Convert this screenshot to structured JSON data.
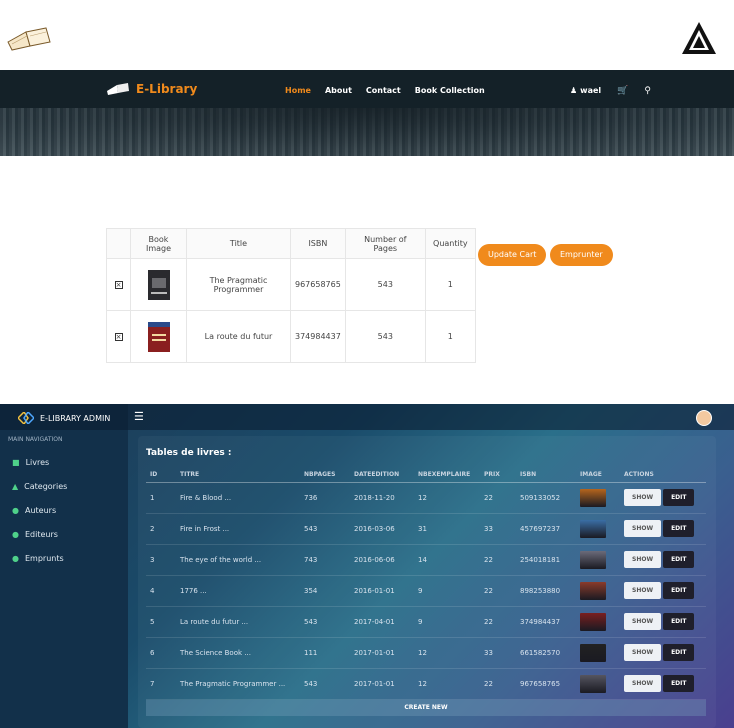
{
  "navbar": {
    "brand": "E-Library",
    "links": [
      "Home",
      "About",
      "Contact",
      "Book Collection"
    ],
    "active_link": "Home",
    "user": "wael"
  },
  "cart": {
    "headers": [
      "",
      "Book Image",
      "Title",
      "ISBN",
      "Number of Pages",
      "Quantity"
    ],
    "rows": [
      {
        "title": "The Pragmatic Programmer",
        "isbn": "967658765",
        "pages": "543",
        "quantity": "1",
        "cover": "dark"
      },
      {
        "title": "La route du futur",
        "isbn": "374984437",
        "pages": "543",
        "quantity": "1",
        "cover": "red"
      }
    ],
    "update_cart": "Update Cart",
    "emprunter": "Emprunter"
  },
  "admin": {
    "brand": "E-LIBRARY ADMIN",
    "sidebar_heading": "MAIN NAVIGATION",
    "sidebar_items": [
      "Livres",
      "Categories",
      "Auteurs",
      "Editeurs",
      "Emprunts"
    ],
    "card_title": "Tables de livres :",
    "columns": [
      "ID",
      "TITRE",
      "NBPAGES",
      "DATEEDITION",
      "NBEXEMPLAIRE",
      "PRIX",
      "ISBN",
      "IMAGE",
      "ACTIONS"
    ],
    "rows": [
      {
        "id": "1",
        "titre": "Fire & Blood ...",
        "nbpages": "736",
        "date": "2018-11-20",
        "nbex": "12",
        "prix": "22",
        "isbn": "509133052",
        "cover": "#b5651d"
      },
      {
        "id": "2",
        "titre": "Fire in Frost ...",
        "nbpages": "543",
        "date": "2016-03-06",
        "nbex": "31",
        "prix": "33",
        "isbn": "457697237",
        "cover": "#3a6ea5"
      },
      {
        "id": "3",
        "titre": "The eye of the world ...",
        "nbpages": "743",
        "date": "2016-06-06",
        "nbex": "14",
        "prix": "22",
        "isbn": "254018181",
        "cover": "#6b6b7a"
      },
      {
        "id": "4",
        "titre": "1776 ...",
        "nbpages": "354",
        "date": "2016-01-01",
        "nbex": "9",
        "prix": "22",
        "isbn": "898253880",
        "cover": "#8a3b2b"
      },
      {
        "id": "5",
        "titre": "La route du futur ...",
        "nbpages": "543",
        "date": "2017-04-01",
        "nbex": "9",
        "prix": "22",
        "isbn": "374984437",
        "cover": "#7a1f1f"
      },
      {
        "id": "6",
        "titre": "The Science Book ...",
        "nbpages": "111",
        "date": "2017-01-01",
        "nbex": "12",
        "prix": "33",
        "isbn": "661582570",
        "cover": "#222222"
      },
      {
        "id": "7",
        "titre": "The Pragmatic Programmer ...",
        "nbpages": "543",
        "date": "2017-01-01",
        "nbex": "12",
        "prix": "22",
        "isbn": "967658765",
        "cover": "#555560"
      }
    ],
    "show_label": "SHOW",
    "edit_label": "EDIT",
    "create_new": "CREATE NEW"
  }
}
